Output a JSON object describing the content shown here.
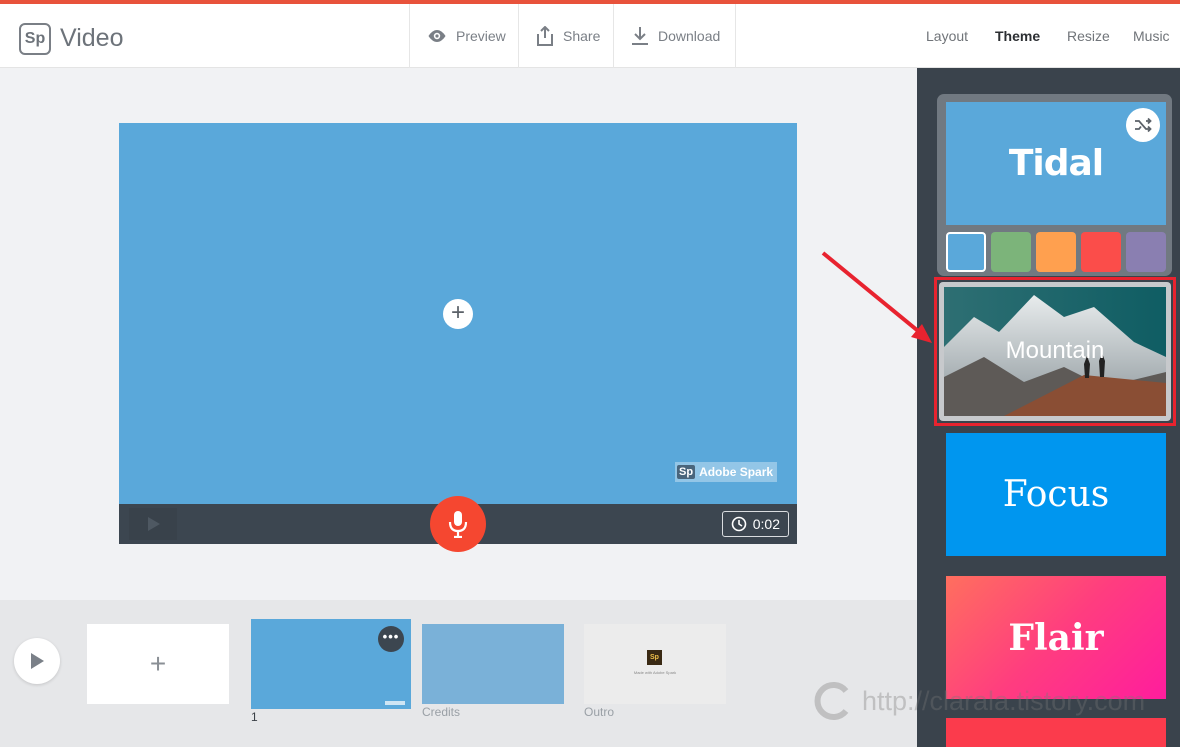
{
  "header": {
    "logo": "Sp",
    "title": "Video",
    "tools": [
      {
        "label": "Preview",
        "icon": "eye-icon"
      },
      {
        "label": "Share",
        "icon": "share-icon"
      },
      {
        "label": "Download",
        "icon": "download-icon"
      }
    ],
    "nav": [
      {
        "label": "Layout",
        "active": false
      },
      {
        "label": "Theme",
        "active": true
      },
      {
        "label": "Resize",
        "active": false
      },
      {
        "label": "Music",
        "active": false
      }
    ]
  },
  "stage": {
    "add_symbol": "+",
    "watermark_logo": "Sp",
    "watermark_text": "Adobe Spark",
    "duration": "0:02"
  },
  "timeline": {
    "add_symbol": "+",
    "slides": [
      {
        "label": "1",
        "more": "•••"
      },
      {
        "label": "Credits"
      },
      {
        "label": "Outro",
        "logo": "Sp",
        "caption": "Made with Adobe Spark"
      }
    ]
  },
  "themes": {
    "tidal": {
      "name": "Tidal",
      "swatches": [
        "#5aa8da",
        "#7cb47a",
        "#ffa04f",
        "#fb4d4a",
        "#8a7fb1"
      ],
      "selected_swatch": 0
    },
    "mountain": {
      "name": "Mountain"
    },
    "focus": {
      "name": "Focus"
    },
    "flair": {
      "name": "Flair"
    }
  },
  "overlay": {
    "site_watermark": "http://clarala.tistory.com"
  },
  "colors": {
    "accent": "#e8523b",
    "mic": "#f54730",
    "highlight": "#e8232f"
  }
}
